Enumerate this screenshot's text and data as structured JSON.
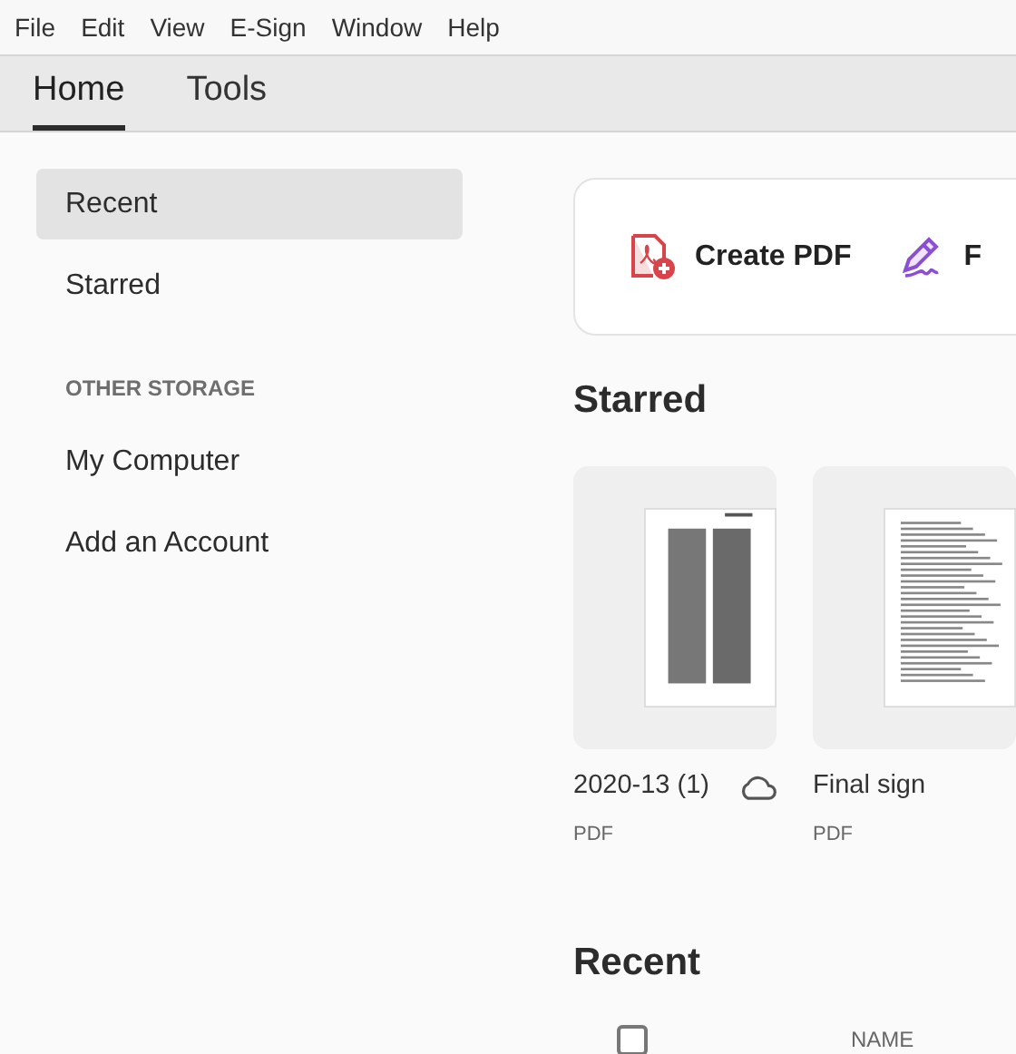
{
  "menu": [
    "File",
    "Edit",
    "View",
    "E-Sign",
    "Window",
    "Help"
  ],
  "tabs": [
    {
      "label": "Home",
      "selected": true
    },
    {
      "label": "Tools",
      "selected": false
    }
  ],
  "sidebar": {
    "items": [
      {
        "label": "Recent",
        "selected": true
      },
      {
        "label": "Starred",
        "selected": false
      }
    ],
    "section_heading": "OTHER STORAGE",
    "storage_items": [
      {
        "label": "My Computer",
        "selected": false
      },
      {
        "label": "Add an Account",
        "selected": false
      }
    ]
  },
  "tools": [
    {
      "label": "Create PDF",
      "kind": "create"
    },
    {
      "label": "F",
      "kind": "sign"
    }
  ],
  "starred": {
    "title": "Starred",
    "files": [
      {
        "name": "2020-13 (1)",
        "type": "PDF",
        "cloud": true,
        "kind": "columns"
      },
      {
        "name": "Final sign",
        "type": "PDF",
        "kind": "list"
      }
    ]
  },
  "recent": {
    "title": "Recent",
    "select_all_checked": false,
    "columns": [
      "NAME"
    ]
  }
}
